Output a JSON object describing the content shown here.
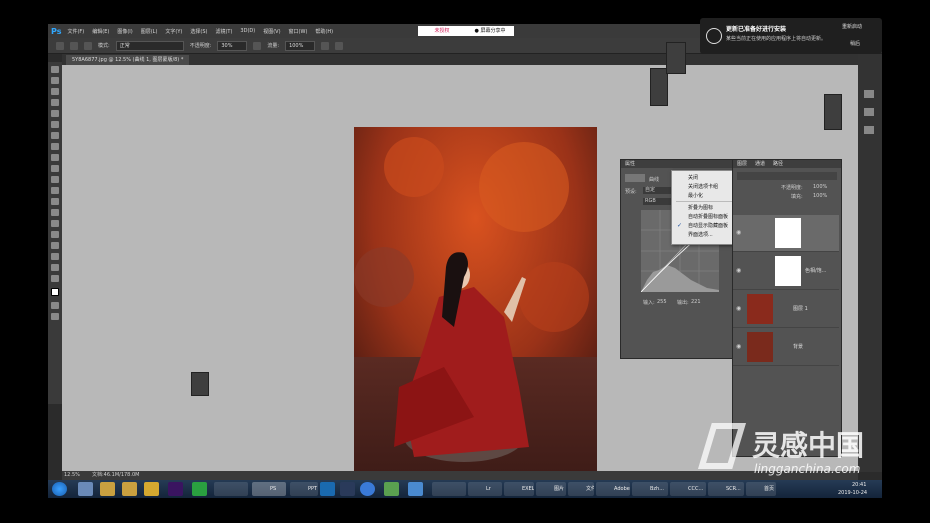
{
  "app": {
    "logo": "Ps"
  },
  "menu": [
    "文件(F)",
    "编辑(E)",
    "图像(I)",
    "图层(L)",
    "文字(Y)",
    "选择(S)",
    "滤镜(T)",
    "3D(D)",
    "视图(V)",
    "窗口(W)",
    "帮助(H)"
  ],
  "options": {
    "mode_label": "模式:",
    "mode_value": "正常",
    "opacity_label": "不透明度:",
    "opacity_value": "30%",
    "flow_label": "流量:",
    "flow_value": "100%"
  },
  "document": {
    "tab": "5Y8A6877.jpg @ 12.5% (曲线 1, 图层蒙版/8) *"
  },
  "top_buttons": {
    "left": "未授权",
    "right": "● 屏幕分享中"
  },
  "notification": {
    "title": "更新已准备好进行安装",
    "body": "某些当前正在使用的应用程序上将自动更新。",
    "restart": "重新启动",
    "later": "稍后"
  },
  "properties": {
    "header": "属性",
    "curve_label": "曲线",
    "preset_label": "预设:",
    "preset_value": "自定",
    "channel_value": "RGB",
    "input_label": "输入:",
    "input_value": "255",
    "output_label": "输出:",
    "output_value": "221"
  },
  "context_menu": {
    "items": [
      "关闭",
      "关闭选项卡组",
      "最小化",
      "折叠为图标",
      "自动折叠图标面板",
      "自动显示隐藏面板",
      "界面选项..."
    ],
    "checked_index": 5
  },
  "layers": {
    "tabs": [
      "图层",
      "通道",
      "路径"
    ],
    "opacity_label": "不透明度:",
    "opacity_value": "100%",
    "fill_label": "填充:",
    "fill_value": "100%",
    "rows": [
      {
        "name": ""
      },
      {
        "name": "色相/饱..."
      },
      {
        "name": "图层 1"
      },
      {
        "name": "背景"
      }
    ]
  },
  "status": {
    "zoom": "12.5%",
    "doc": "文档:46.1M/178.0M"
  },
  "taskbar": {
    "items": [
      "PS",
      "PPT",
      "Lr",
      "EXEL",
      "图片",
      "文件",
      "Adobe",
      "Bzh...",
      "CCC...",
      "SCR...",
      "首页"
    ],
    "clock_time": "20:41",
    "clock_date": "2019-10-24"
  },
  "watermark": {
    "brand": "灵感中国",
    "url": "lingganchina.com"
  },
  "colors": {
    "photo_red": "#9b2a24",
    "leaves": "#c1461f",
    "ps_blue": "#31a8ff"
  }
}
